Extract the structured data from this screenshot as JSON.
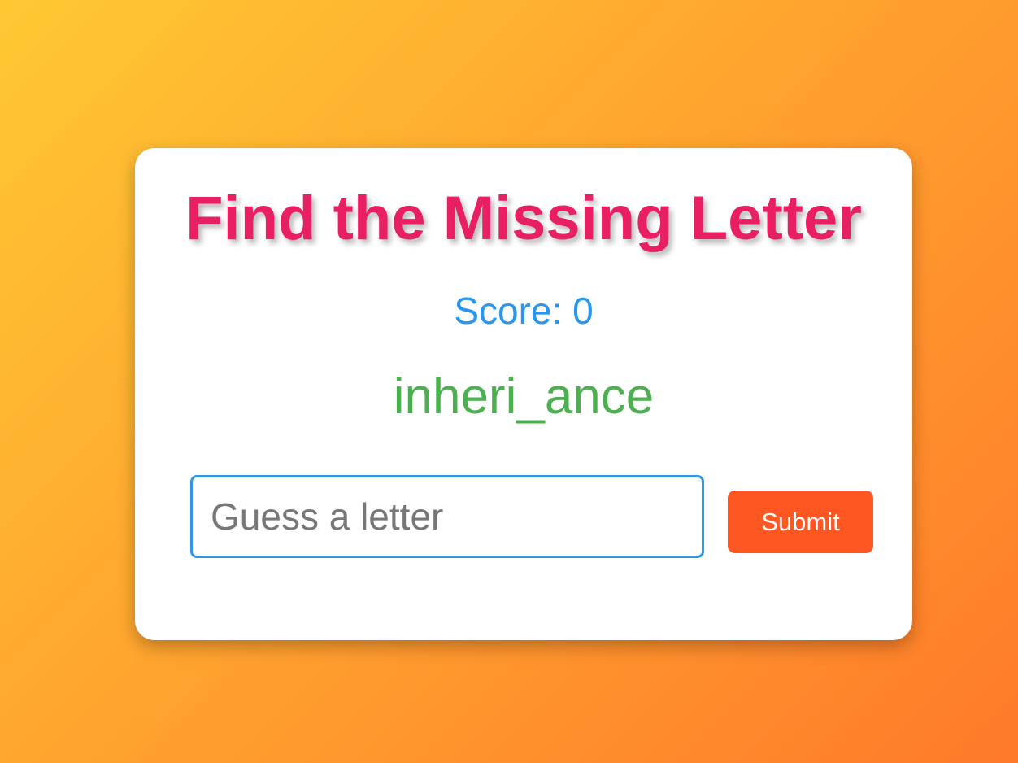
{
  "game": {
    "title": "Find the Missing Letter",
    "score_text": "Score: 0",
    "score": 0,
    "word_puzzle": "inheri_ance",
    "input": {
      "value": "",
      "placeholder": "Guess a letter"
    },
    "submit_label": "Submit"
  },
  "colors": {
    "title": "#e91f63",
    "score": "#2a96ee",
    "word": "#4caf50",
    "submit_bg": "#ff5722",
    "submit_text": "#ffffff",
    "input_border": "#2f97e6",
    "background_start": "#ffc833",
    "background_end": "#ff7a2a"
  }
}
